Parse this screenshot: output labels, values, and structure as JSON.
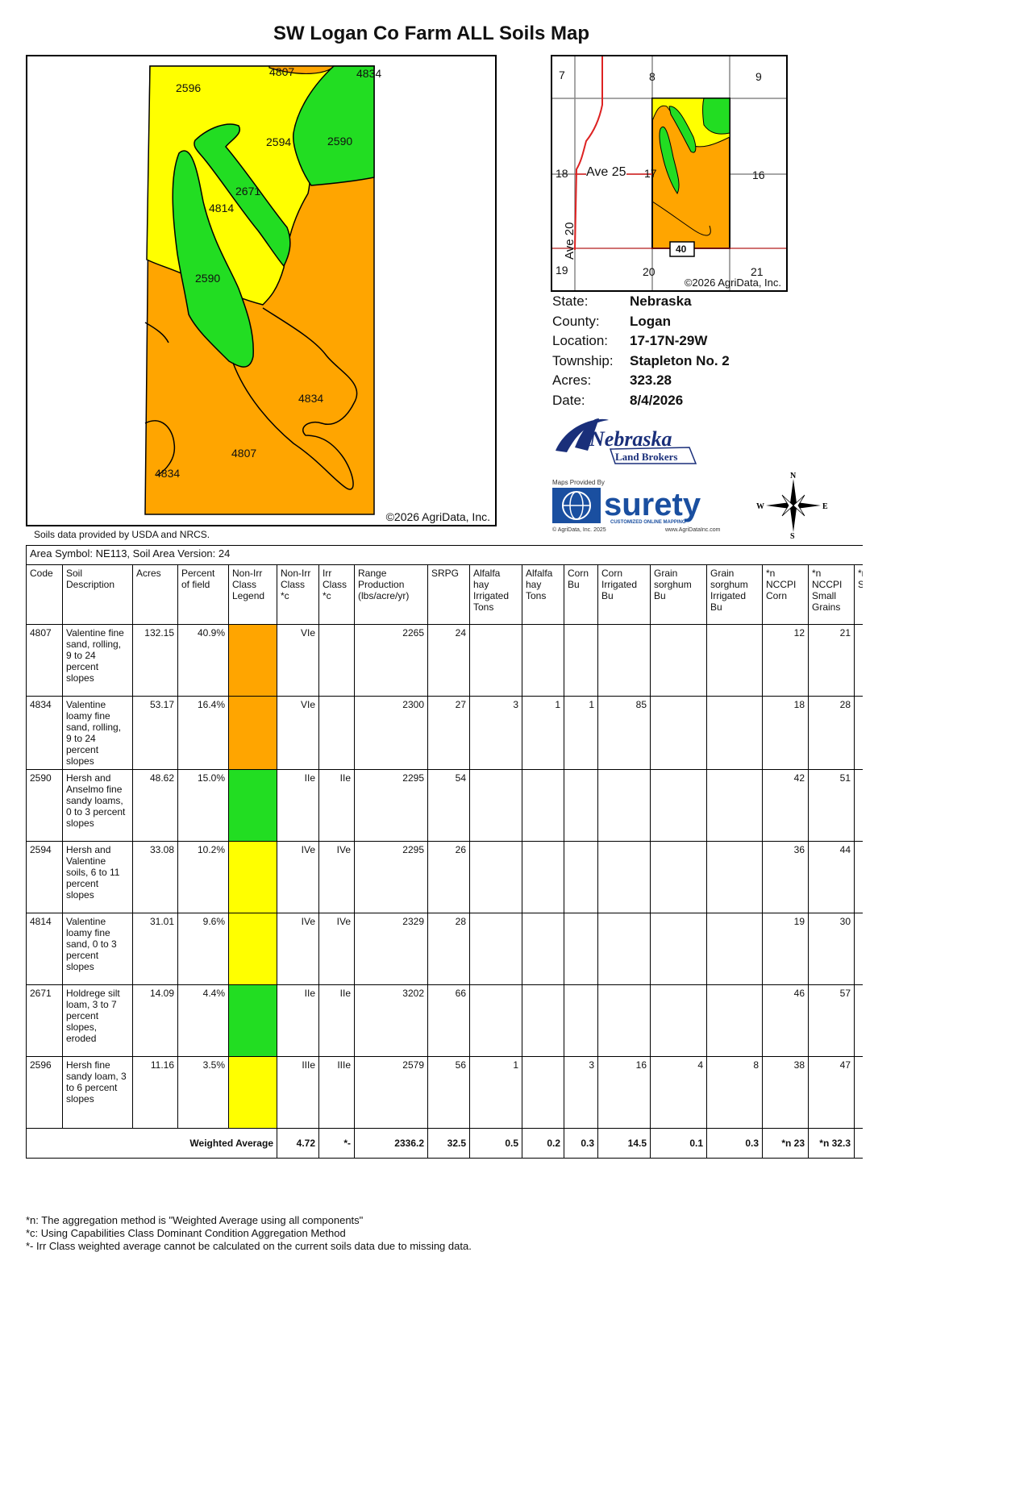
{
  "title": "SW Logan Co Farm ALL Soils Map",
  "main_map": {
    "labels": [
      "4807",
      "4834",
      "2596",
      "2594",
      "2590",
      "2671",
      "4814",
      "2590",
      "4834",
      "4807",
      "4834"
    ],
    "copyright": "©2026 AgriData, Inc."
  },
  "soils_note": "Soils data provided by USDA and NRCS.",
  "locator_map": {
    "sections": [
      "7",
      "8",
      "9",
      "18",
      "17",
      "16",
      "19",
      "20",
      "21"
    ],
    "road_ave25": "Ave 25",
    "road_ave20": "Ave 20",
    "highway": "40",
    "copyright": "©2026 AgriData, Inc."
  },
  "info": [
    {
      "label": "State:",
      "value": "Nebraska"
    },
    {
      "label": "County:",
      "value": "Logan"
    },
    {
      "label": "Location:",
      "value": "17-17N-29W"
    },
    {
      "label": "Township:",
      "value": "Stapleton No. 2"
    },
    {
      "label": "Acres:",
      "value": "323.28"
    },
    {
      "label": "Date:",
      "value": "8/4/2026"
    }
  ],
  "logo_nlb": {
    "name": "Nebraska",
    "sub": "Land Brokers"
  },
  "logo_surety": {
    "provided": "Maps Provided By",
    "name": "surety",
    "tag": "CUSTOMIZED ONLINE MAPPING",
    "left_note": "© AgriData, Inc. 2025",
    "right_note": "www.AgriDataInc.com"
  },
  "compass": {
    "n": "N",
    "s": "S",
    "e": "E",
    "w": "W"
  },
  "colors": {
    "orange": "#ffa500",
    "green": "#22dd22",
    "yellow": "#ffff00"
  },
  "table": {
    "area_symbol": "Area Symbol: NE113, Soil Area Version: 24",
    "headers": [
      "Code",
      "Soil Description",
      "Acres",
      "Percent of field",
      "Non-Irr Class Legend",
      "Non-Irr Class *c",
      "Irr Class *c",
      "Range Production (lbs/acre/yr)",
      "SRPG",
      "Alfalfa hay Irrigated Tons",
      "Alfalfa hay Tons",
      "Corn Bu",
      "Corn Irrigated Bu",
      "Grain sorghum Bu",
      "Grain sorghum Irrigated Bu",
      "*n NCCPI Corn",
      "*n NCCPI Small Grains",
      "*n NCCPI Soybeans"
    ],
    "rows": [
      {
        "code": "4807",
        "desc": "Valentine fine sand, rolling, 9 to 24 percent slopes",
        "acres": "132.15",
        "pct": "40.9%",
        "color": "orange",
        "nonirr": "VIe",
        "irr": "",
        "range": "2265",
        "srpg": "24",
        "alf_irr": "",
        "alf": "",
        "corn": "",
        "corn_irr": "",
        "gs": "",
        "gs_irr": "",
        "nccpi_corn": "12",
        "nccpi_sg": "21"
      },
      {
        "code": "4834",
        "desc": "Valentine loamy fine sand, rolling, 9 to 24 percent slopes",
        "acres": "53.17",
        "pct": "16.4%",
        "color": "orange",
        "nonirr": "VIe",
        "irr": "",
        "range": "2300",
        "srpg": "27",
        "alf_irr": "3",
        "alf": "1",
        "corn": "1",
        "corn_irr": "85",
        "gs": "",
        "gs_irr": "",
        "nccpi_corn": "18",
        "nccpi_sg": "28"
      },
      {
        "code": "2590",
        "desc": "Hersh and Anselmo fine sandy loams, 0 to 3 percent slopes",
        "acres": "48.62",
        "pct": "15.0%",
        "color": "green",
        "nonirr": "IIe",
        "irr": "IIe",
        "range": "2295",
        "srpg": "54",
        "alf_irr": "",
        "alf": "",
        "corn": "",
        "corn_irr": "",
        "gs": "",
        "gs_irr": "",
        "nccpi_corn": "42",
        "nccpi_sg": "51"
      },
      {
        "code": "2594",
        "desc": "Hersh and Valentine soils, 6 to 11 percent slopes",
        "acres": "33.08",
        "pct": "10.2%",
        "color": "yellow",
        "nonirr": "IVe",
        "irr": "IVe",
        "range": "2295",
        "srpg": "26",
        "alf_irr": "",
        "alf": "",
        "corn": "",
        "corn_irr": "",
        "gs": "",
        "gs_irr": "",
        "nccpi_corn": "36",
        "nccpi_sg": "44"
      },
      {
        "code": "4814",
        "desc": "Valentine loamy fine sand, 0 to 3 percent slopes",
        "acres": "31.01",
        "pct": "9.6%",
        "color": "yellow",
        "nonirr": "IVe",
        "irr": "IVe",
        "range": "2329",
        "srpg": "28",
        "alf_irr": "",
        "alf": "",
        "corn": "",
        "corn_irr": "",
        "gs": "",
        "gs_irr": "",
        "nccpi_corn": "19",
        "nccpi_sg": "30"
      },
      {
        "code": "2671",
        "desc": "Holdrege silt loam, 3 to 7 percent slopes, eroded",
        "acres": "14.09",
        "pct": "4.4%",
        "color": "green",
        "nonirr": "IIe",
        "irr": "IIe",
        "range": "3202",
        "srpg": "66",
        "alf_irr": "",
        "alf": "",
        "corn": "",
        "corn_irr": "",
        "gs": "",
        "gs_irr": "",
        "nccpi_corn": "46",
        "nccpi_sg": "57"
      },
      {
        "code": "2596",
        "desc": "Hersh fine sandy loam, 3 to 6 percent slopes",
        "acres": "11.16",
        "pct": "3.5%",
        "color": "yellow",
        "nonirr": "IIIe",
        "irr": "IIIe",
        "range": "2579",
        "srpg": "56",
        "alf_irr": "1",
        "alf": "",
        "corn": "3",
        "corn_irr": "16",
        "gs": "4",
        "gs_irr": "8",
        "nccpi_corn": "38",
        "nccpi_sg": "47"
      }
    ],
    "weighted": {
      "label": "Weighted Average",
      "nonirr": "4.72",
      "irr": "*-",
      "range": "2336.2",
      "srpg": "32.5",
      "alf_irr": "0.5",
      "alf": "0.2",
      "corn": "0.3",
      "corn_irr": "14.5",
      "gs": "0.1",
      "gs_irr": "0.3",
      "nccpi_corn": "*n 23",
      "nccpi_sg": "*n 32.3"
    }
  },
  "footnotes": [
    "*n: The aggregation method is \"Weighted Average using all components\"",
    "*c: Using Capabilities Class Dominant Condition Aggregation Method",
    "*- Irr Class weighted average cannot be calculated on the current soils data due to missing data."
  ]
}
